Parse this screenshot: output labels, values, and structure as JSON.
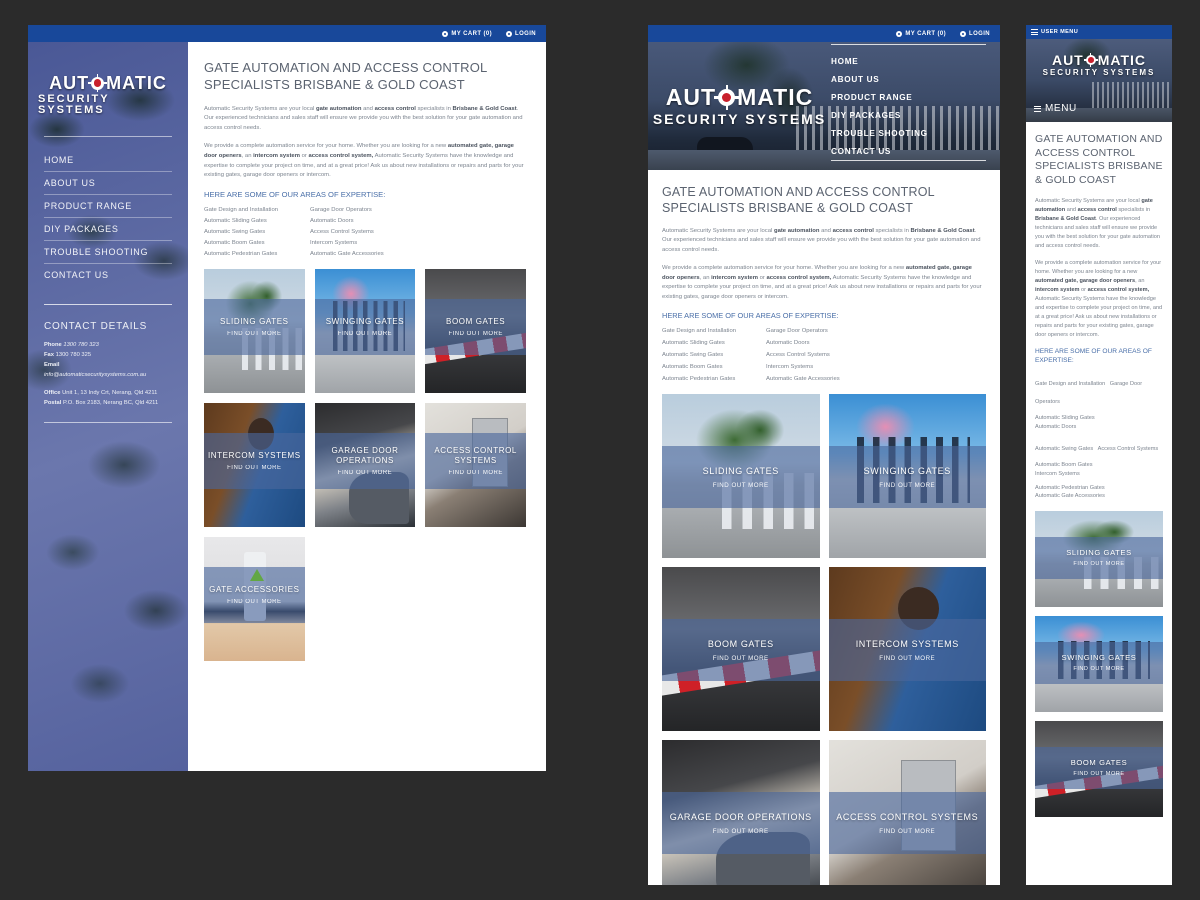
{
  "topbar": {
    "cart": "MY CART (0)",
    "login": "LOGIN"
  },
  "brand": {
    "line1_a": "AUT",
    "line1_b": "MATIC",
    "line2": "SECURITY SYSTEMS"
  },
  "nav": [
    {
      "label": "HOME"
    },
    {
      "label": "ABOUT US"
    },
    {
      "label": "PRODUCT RANGE"
    },
    {
      "label": "DIY PACKAGES"
    },
    {
      "label": "TROUBLE SHOOTING"
    },
    {
      "label": "CONTACT US"
    }
  ],
  "contact": {
    "title": "CONTACT DETAILS",
    "phone_label": "Phone",
    "phone": "1300 780 323",
    "fax_label": "Fax",
    "fax": "1300 780 325",
    "email_label": "Email",
    "email": "info@automaticsecuritysystems.com.au",
    "office_label": "Office",
    "office": "Unit 1, 13 Indy Crt, Nerang, Qld 4211",
    "postal_label": "Postal",
    "postal": "P.O. Box 2183, Nerang BC, Qld 4211"
  },
  "main": {
    "heading": "GATE AUTOMATION AND ACCESS CONTROL SPECIALISTS BRISBANE & GOLD COAST",
    "heading_mobile": "GATE AUTOMATION AND ACCESS CONTROL SPECIALISTS BRISBANE & GOLD COAST",
    "p1_a": "Automatic Security Systems are your local ",
    "p1_b1": "gate automation",
    "p1_c": " and ",
    "p1_b2": "access control",
    "p1_d": " specialists in ",
    "p1_b3": "Brisbane & Gold Coast",
    "p1_e": ". Our experienced technicians and sales staff will ensure we provide you with the best solution for your gate automation and access control needs.",
    "p2_a": "We provide a complete automation service for your home. Whether you are looking for a new ",
    "p2_b1": "automated gate, garage door openers",
    "p2_c": ", an ",
    "p2_b2": "intercom system",
    "p2_d": " or ",
    "p2_b3": "access control system,",
    "p2_e": " Automatic Security Systems have the knowledge and expertise to complete your project on time, and at a great price! Ask us about new installations or repairs and parts for your existing gates, garage door openers or intercom.",
    "expertise_heading": "HERE ARE SOME OF OUR AREAS OF EXPERTISE:"
  },
  "services": [
    {
      "left": "Gate Design and Installation",
      "right": "Garage Door Operators"
    },
    {
      "left": "Automatic Sliding Gates",
      "right": "Automatic Doors"
    },
    {
      "left": "Automatic Swing Gates",
      "right": "Access Control Systems"
    },
    {
      "left": "Automatic Boom Gates",
      "right": "Intercom Systems"
    },
    {
      "left": "Automatic Pedestrian Gates",
      "right": "Automatic Gate Accessories"
    }
  ],
  "cards": [
    {
      "title": "SLIDING GATES",
      "sub": "FIND OUT MORE",
      "scene": "sc-sliding"
    },
    {
      "title": "SWINGING GATES",
      "sub": "FIND OUT MORE",
      "scene": "sc-swinging"
    },
    {
      "title": "BOOM GATES",
      "sub": "FIND OUT MORE",
      "scene": "sc-boom"
    },
    {
      "title": "INTERCOM SYSTEMS",
      "sub": "FIND OUT MORE",
      "scene": "sc-intercom"
    },
    {
      "title": "GARAGE DOOR OPERATIONS",
      "sub": "FIND OUT MORE",
      "scene": "sc-garage"
    },
    {
      "title": "ACCESS CONTROL SYSTEMS",
      "sub": "FIND OUT MORE",
      "scene": "sc-access"
    },
    {
      "title": "GATE ACCESSORIES",
      "sub": "FIND OUT MORE",
      "scene": "sc-accessories"
    }
  ],
  "mobile": {
    "user_menu": "USER MENU",
    "menu": "MENU"
  },
  "colors": {
    "topbar_blue": "#18489a",
    "sidebar_purple": "#5e6ba4",
    "heading_grey": "#5b6370",
    "link_blue": "#4a6fa8",
    "overlay_blue": "rgba(74,104,156,.62)",
    "page_bg": "#2b2b2b"
  }
}
